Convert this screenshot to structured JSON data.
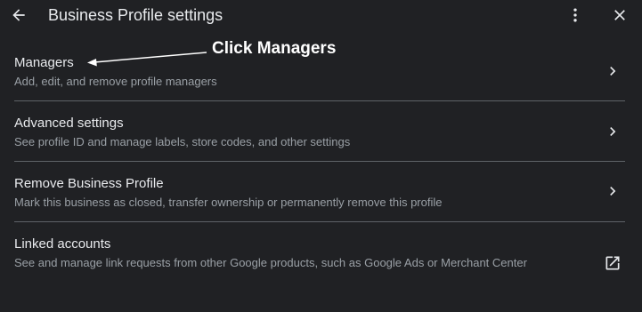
{
  "header": {
    "title": "Business Profile settings",
    "back_icon": "arrow-back-icon",
    "more_icon": "more-vert-icon",
    "close_icon": "close-icon"
  },
  "annotation": {
    "text": "Click Managers"
  },
  "items": [
    {
      "title": "Managers",
      "description": "Add, edit, and remove profile managers",
      "trailing_icon": "chevron-right-icon"
    },
    {
      "title": "Advanced settings",
      "description": "See profile ID and manage labels, store codes, and other settings",
      "trailing_icon": "chevron-right-icon"
    },
    {
      "title": "Remove Business Profile",
      "description": "Mark this business as closed, transfer ownership or permanently remove this profile",
      "trailing_icon": "chevron-right-icon"
    },
    {
      "title": "Linked accounts",
      "description": "See and manage link requests from other Google products, such as Google Ads or Merchant Center",
      "trailing_icon": "open-in-new-icon"
    }
  ],
  "colors": {
    "background": "#202124",
    "primary_text": "#e8eaed",
    "secondary_text": "#9aa0a6",
    "divider": "#5f6368",
    "annotation": "#ffffff"
  }
}
